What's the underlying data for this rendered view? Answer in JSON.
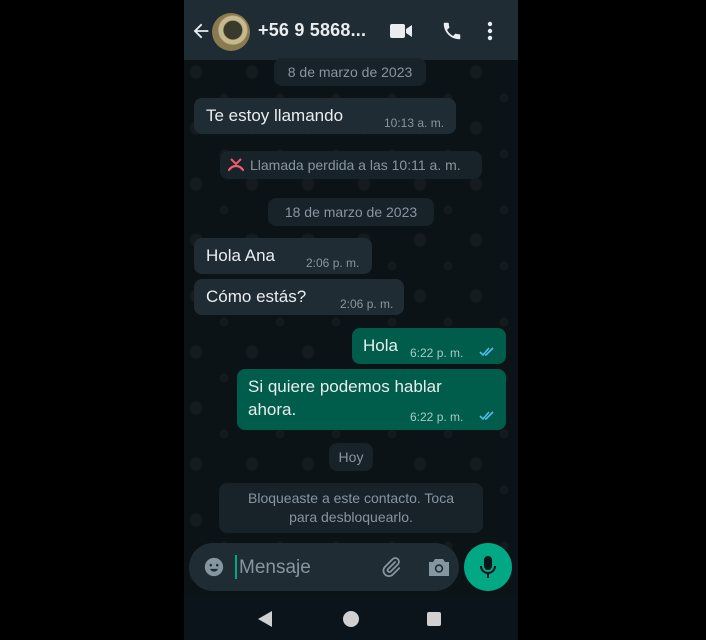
{
  "header": {
    "contact_name": "+56 9 5868...",
    "icons": [
      "back-arrow-icon",
      "video-call-icon",
      "voice-call-icon",
      "more-options-icon"
    ]
  },
  "chat": {
    "date_1": "8 de marzo de 2023",
    "messages_day1": [
      {
        "text": "Te estoy llamando",
        "time": "10:13 a. m.",
        "direction": "incoming"
      }
    ],
    "missed_call": "Llamada perdida a las 10:11 a. m.",
    "date_2": "18 de marzo de 2023",
    "messages_day2": [
      {
        "text": "Hola Ana",
        "time": "2:06 p. m.",
        "direction": "incoming"
      },
      {
        "text": "Cómo estás?",
        "time": "2:06 p. m.",
        "direction": "incoming"
      },
      {
        "text": "Hola",
        "time": "6:22 p. m.",
        "direction": "outgoing",
        "read": true
      },
      {
        "text_line1": "Si quiere podemos hablar",
        "text_line2": "ahora.",
        "time": "6:22 p. m.",
        "direction": "outgoing",
        "read": true
      }
    ],
    "date_today": "Hoy",
    "blocked_line1": "Bloqueaste a este contacto. Toca",
    "blocked_line2": "para desbloquearlo."
  },
  "composer": {
    "placeholder": "Mensaje",
    "value": ""
  },
  "colors": {
    "accent": "#00a884",
    "outgoing_bubble": "#005c4b",
    "incoming_bubble": "#202c33",
    "read_ticks": "#53bdeb",
    "missed_call": "#f15c6d"
  }
}
